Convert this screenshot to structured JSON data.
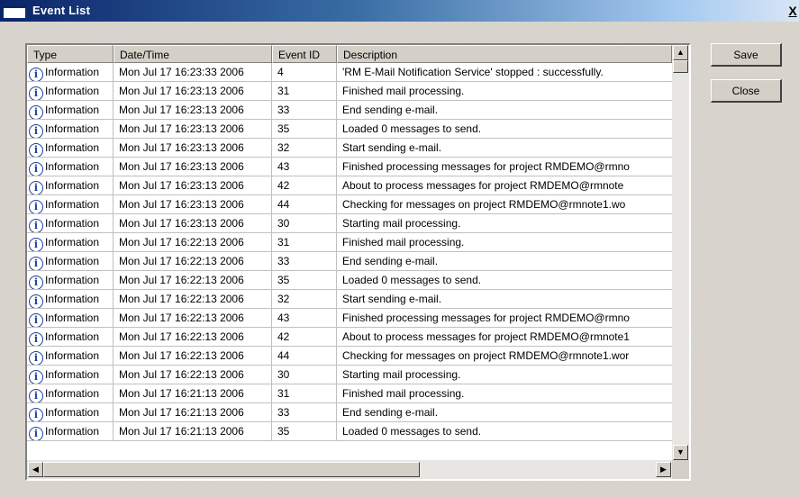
{
  "window": {
    "title": "Event List",
    "close_label": "X"
  },
  "columns": {
    "type": "Type",
    "date": "Date/Time",
    "id": "Event ID",
    "description": "Description"
  },
  "rows": [
    {
      "type": "Information",
      "date": "Mon Jul 17 16:23:33 2006",
      "id": "4",
      "description": "'RM  E-Mail Notification Service' stopped : successfully."
    },
    {
      "type": "Information",
      "date": "Mon Jul 17 16:23:13 2006",
      "id": "31",
      "description": "Finished mail processing."
    },
    {
      "type": "Information",
      "date": "Mon Jul 17 16:23:13 2006",
      "id": "33",
      "description": "End sending e-mail."
    },
    {
      "type": "Information",
      "date": "Mon Jul 17 16:23:13 2006",
      "id": "35",
      "description": "Loaded 0 messages to send."
    },
    {
      "type": "Information",
      "date": "Mon Jul 17 16:23:13 2006",
      "id": "32",
      "description": "Start sending e-mail."
    },
    {
      "type": "Information",
      "date": "Mon Jul 17 16:23:13 2006",
      "id": "43",
      "description": "Finished processing messages for project  RMDEMO@rmno"
    },
    {
      "type": "Information",
      "date": "Mon Jul 17 16:23:13 2006",
      "id": "42",
      "description": "About to process messages for project  RMDEMO@rmnote"
    },
    {
      "type": "Information",
      "date": "Mon Jul 17 16:23:13 2006",
      "id": "44",
      "description": "Checking for messages on project  RMDEMO@rmnote1.wo"
    },
    {
      "type": "Information",
      "date": "Mon Jul 17 16:23:13 2006",
      "id": "30",
      "description": "Starting mail processing."
    },
    {
      "type": "Information",
      "date": "Mon Jul 17 16:22:13 2006",
      "id": "31",
      "description": "Finished mail processing."
    },
    {
      "type": "Information",
      "date": "Mon Jul 17 16:22:13 2006",
      "id": "33",
      "description": "End sending e-mail."
    },
    {
      "type": "Information",
      "date": "Mon Jul 17 16:22:13 2006",
      "id": "35",
      "description": "Loaded 0 messages to send."
    },
    {
      "type": "Information",
      "date": "Mon Jul 17 16:22:13 2006",
      "id": "32",
      "description": "Start sending e-mail."
    },
    {
      "type": "Information",
      "date": "Mon Jul 17 16:22:13 2006",
      "id": "43",
      "description": "Finished processing messages for project  RMDEMO@rmno"
    },
    {
      "type": "Information",
      "date": "Mon Jul 17 16:22:13 2006",
      "id": "42",
      "description": "About to process messages for project RMDEMO@rmnote1"
    },
    {
      "type": "Information",
      "date": "Mon Jul 17 16:22:13 2006",
      "id": "44",
      "description": "Checking for messages on project RMDEMO@rmnote1.wor"
    },
    {
      "type": "Information",
      "date": "Mon Jul 17 16:22:13 2006",
      "id": "30",
      "description": "Starting mail processing."
    },
    {
      "type": "Information",
      "date": "Mon Jul 17 16:21:13 2006",
      "id": "31",
      "description": "Finished mail processing."
    },
    {
      "type": "Information",
      "date": "Mon Jul 17 16:21:13 2006",
      "id": "33",
      "description": "End sending e-mail."
    },
    {
      "type": "Information",
      "date": "Mon Jul 17 16:21:13 2006",
      "id": "35",
      "description": "Loaded 0 messages to send."
    }
  ],
  "buttons": {
    "save": "Save",
    "close": "Close"
  },
  "icons": {
    "row_icon": "information-icon",
    "row_icon_glyph": "i"
  },
  "colors": {
    "title_start": "#0a246a",
    "title_end": "#a6caf0",
    "face": "#d4d0c8"
  }
}
